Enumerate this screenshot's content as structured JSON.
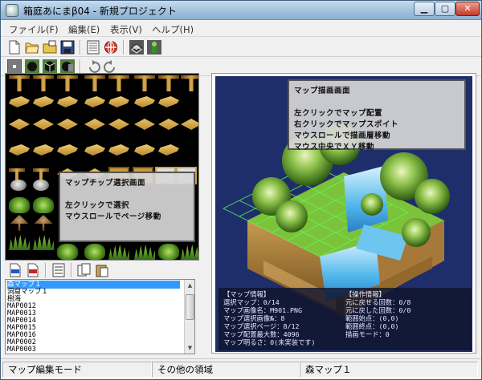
{
  "window": {
    "title": "箱庭あにまβ04 - 新規プロジェクト"
  },
  "menu": [
    "ファイル(F)",
    "編集(E)",
    "表示(V)",
    "ヘルプ(H)"
  ],
  "chip_info": {
    "lines": [
      "マップチップ選択画面",
      "",
      "左クリックで選択",
      "マウスロールでページ移動"
    ]
  },
  "map_info": {
    "lines": [
      "マップ描画画面",
      "",
      "左クリックでマップ配置",
      "右クリックでマップスポイト",
      "マウスロールで描画層移動",
      "マウス中央でＸＹ移動"
    ]
  },
  "map_list": {
    "items": [
      "森マップ１",
      "洞窟マップ１",
      "樹海",
      "MAP0012",
      "MAP0013",
      "MAP0014",
      "MAP0015",
      "MAP0016",
      "MAP0002",
      "MAP0003"
    ],
    "selected_index": 0
  },
  "map_status": {
    "left_header": "【マップ情報】",
    "left_lines": [
      "選択マップ：0/14",
      "マップ画像名：M901.PNG",
      "マップ選択画像№：8",
      "マップ選択ページ：8/12",
      "マップ配置最大数：4096",
      "マップ明るさ：0(未実装です)"
    ],
    "right_header": "【操作情報】",
    "right_lines": [
      "元に戻せる回数：0/8",
      "元に戻した回数：0/0",
      "範囲始点：(0,0)",
      "範囲終点：(0,0)",
      "描画モード：0"
    ]
  },
  "statusbar": {
    "mode": "マップ編集モード",
    "area": "その他の領域",
    "map_name": "森マップ１"
  },
  "colors": {
    "title_gradient_top": "#c7dcef",
    "selection": "#3399ff",
    "map_bg": "#1e2e6a",
    "water": "#4fb6ea",
    "grass": "#7cc23a"
  }
}
